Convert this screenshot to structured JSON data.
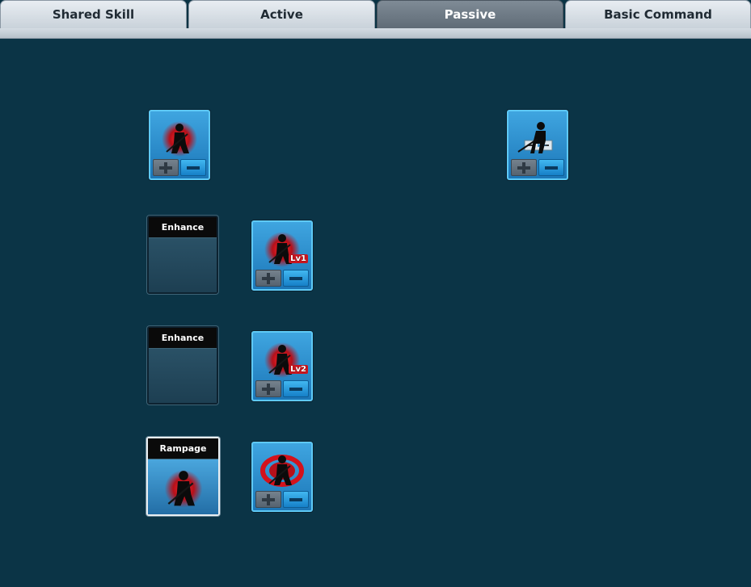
{
  "tabs": [
    {
      "label": "Shared Skill"
    },
    {
      "label": "Active"
    },
    {
      "label": "Passive"
    },
    {
      "label": "Basic Command"
    }
  ],
  "active_tab": "Passive",
  "slots": [
    {
      "label": "Enhance"
    },
    {
      "label": "Enhance"
    },
    {
      "label": "Rampage"
    }
  ],
  "skills": [
    {
      "icon": "dark-aura-warrior-icon"
    },
    {
      "icon": "dash-strike-icon"
    },
    {
      "icon": "aura-warrior-lv1-icon",
      "level": "Lv1"
    },
    {
      "icon": "aura-warrior-lv2-icon",
      "level": "Lv2"
    },
    {
      "icon": "red-vortex-warrior-icon"
    }
  ],
  "colors": {
    "background": "#0b3446",
    "skill_blue": "#2a8fd0",
    "skill_border": "#5ec9f5",
    "aura_red": "#c9151f"
  }
}
